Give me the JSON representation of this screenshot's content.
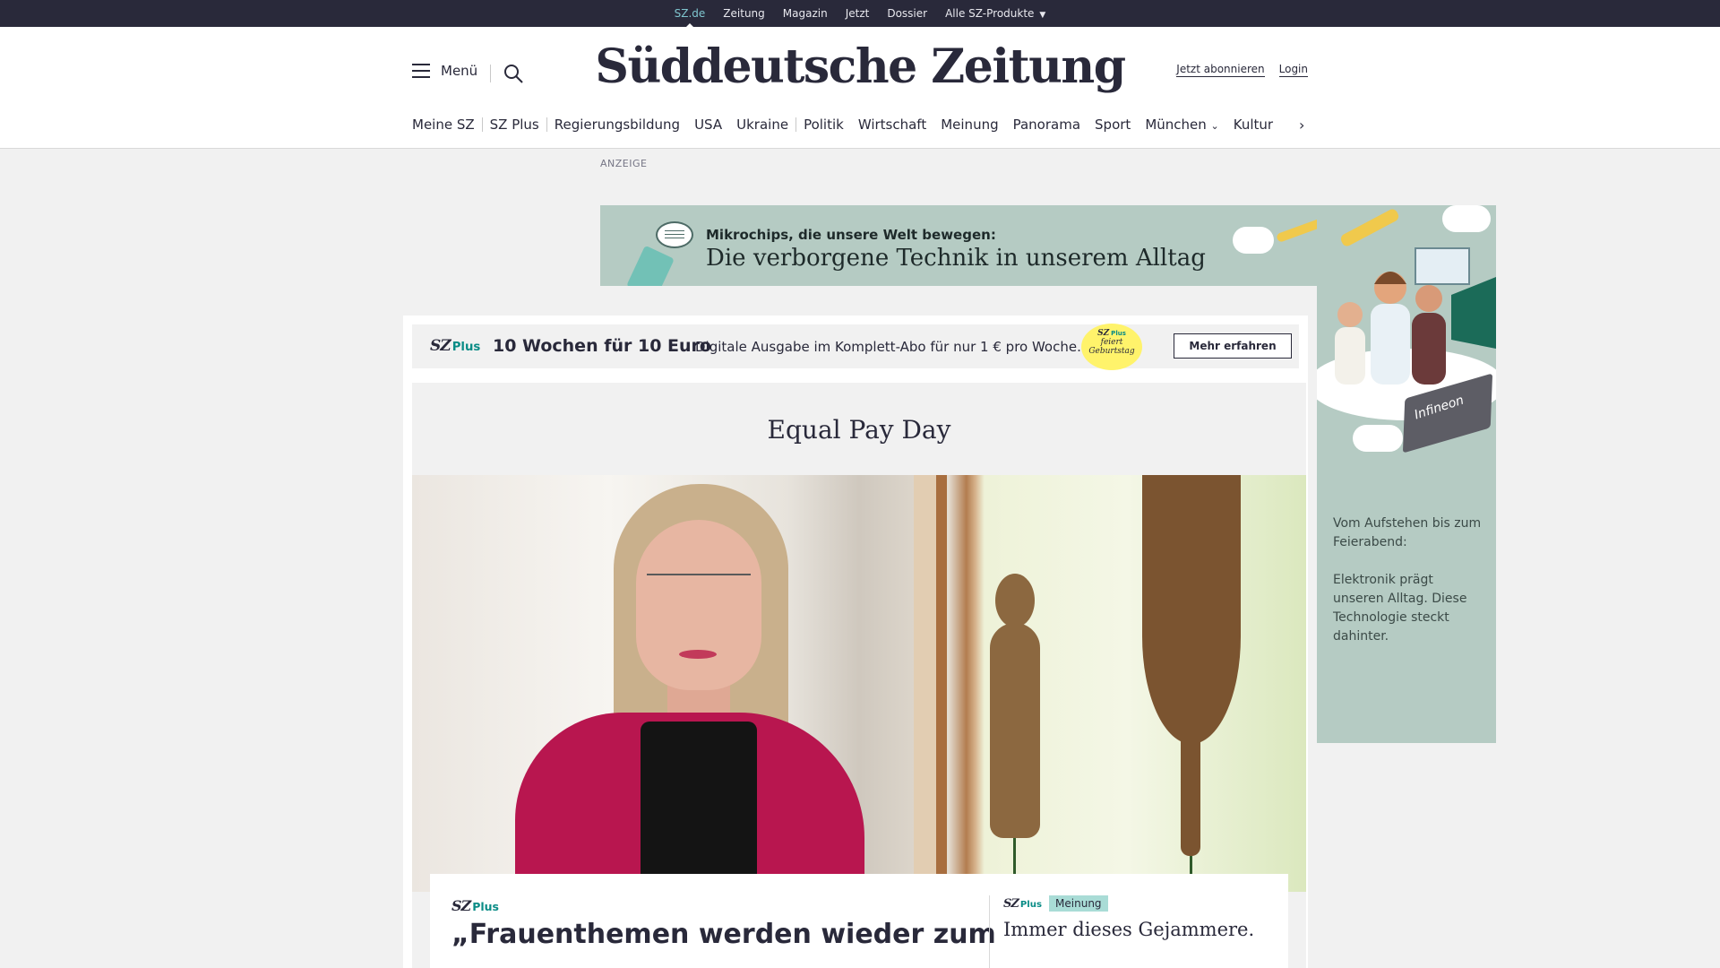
{
  "topbar": {
    "items": [
      "SZ.de",
      "Zeitung",
      "Magazin",
      "Jetzt",
      "Dossier",
      "Alle SZ-Produkte"
    ],
    "active": "SZ.de"
  },
  "header": {
    "menu_label": "Menü",
    "logo": "Süddeutsche Zeitung",
    "subscribe": "Jetzt abonnieren",
    "login": "Login"
  },
  "nav": {
    "items": [
      "Meine SZ",
      "SZ Plus",
      "Regierungsbildung",
      "USA",
      "Ukraine",
      "Politik",
      "Wirtschaft",
      "Meinung",
      "Panorama",
      "Sport",
      "München",
      "Kultur"
    ]
  },
  "ad": {
    "label": "ANZEIGE",
    "banner_sub": "Mikrochips, die unsere Welt bewegen:",
    "banner_title": "Die verborgene Technik in unserem Alltag",
    "sky_chip": "Infineon",
    "sky_text_1": "Vom Aufstehen bis zum Feierabend:",
    "sky_text_2": "Elektronik prägt unseren Alltag. Diese Technologie steckt dahinter."
  },
  "promo": {
    "brand_sz": "SZ",
    "brand_plus": "Plus",
    "headline": "10 Wochen für 10 Euro",
    "description": "Digitale Ausgabe im Komplett-Abo für nur 1 € pro Woche.",
    "badge_line1": "SZ",
    "badge_line1_plus": "Plus",
    "badge_line2": "feiert",
    "badge_line3": "Geburtstag",
    "button": "Mehr erfahren"
  },
  "topic": {
    "title": "Equal Pay Day"
  },
  "cards": [
    {
      "brand_sz": "SZ",
      "brand_plus": "Plus",
      "title": "„Frauenthemen werden wieder zum"
    },
    {
      "brand_sz": "SZ",
      "brand_plus": "Plus",
      "tag": "Meinung",
      "title": "Immer dieses Gejammere."
    }
  ],
  "colors": {
    "dark": "#29293a",
    "teal_accent": "#0a8c86",
    "ad_green": "#b5cbc3",
    "badge_yellow": "#fff36b",
    "tag_teal": "#a9dcd6"
  },
  "icons": [
    "hamburger-icon",
    "search-icon",
    "chevron-down-icon",
    "chevron-right-icon"
  ]
}
